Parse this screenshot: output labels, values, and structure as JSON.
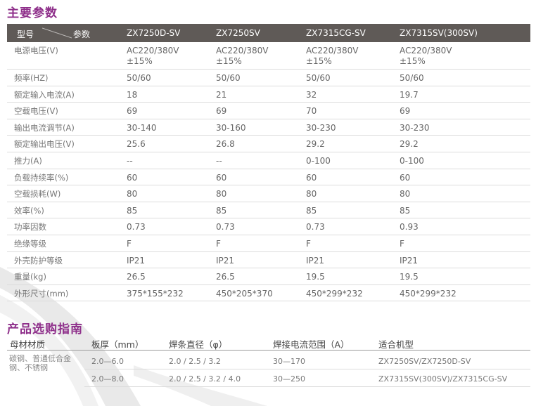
{
  "section1_title": "主要参数",
  "section2_title": "产品选购指南",
  "spec": {
    "header": {
      "type_label": "型号",
      "param_label": "参数",
      "models": [
        "ZX7250D-SV",
        "ZX7250SV",
        "ZX7315CG-SV",
        "ZX7315SV(300SV)"
      ]
    },
    "rows": [
      {
        "label": "电源电压(V)",
        "values": [
          "AC220/380V ±15%",
          "AC220/380V ±15%",
          "AC220/380V ±15%",
          "AC220/380V ±15%"
        ]
      },
      {
        "label": "频率(HZ)",
        "values": [
          "50/60",
          "50/60",
          "50/60",
          "50/60"
        ]
      },
      {
        "label": "额定输入电流(A)",
        "values": [
          "18",
          "21",
          "32",
          "19.7"
        ]
      },
      {
        "label": "空载电压(V)",
        "values": [
          "69",
          "69",
          "70",
          "69"
        ]
      },
      {
        "label": "输出电流调节(A)",
        "values": [
          "30-140",
          "30-160",
          "30-230",
          "30-230"
        ]
      },
      {
        "label": "额定输出电压(V)",
        "values": [
          "25.6",
          "26.8",
          "29.2",
          "29.2"
        ]
      },
      {
        "label": "推力(A)",
        "values": [
          "--",
          "--",
          "0-100",
          "0-100"
        ]
      },
      {
        "label": "负载持续率(%)",
        "values": [
          "60",
          "60",
          "60",
          "60"
        ]
      },
      {
        "label": "空载损耗(W)",
        "values": [
          "80",
          "80",
          "80",
          "80"
        ]
      },
      {
        "label": "效率(%)",
        "values": [
          "85",
          "85",
          "85",
          "85"
        ]
      },
      {
        "label": "功率因数",
        "values": [
          "0.73",
          "0.73",
          "0.73",
          "0.93"
        ]
      },
      {
        "label": "绝缘等级",
        "values": [
          "F",
          "F",
          "F",
          "F"
        ]
      },
      {
        "label": "外壳防护等级",
        "values": [
          "IP21",
          "IP21",
          "IP21",
          "IP21"
        ]
      },
      {
        "label": "重量(kg)",
        "values": [
          "26.5",
          "26.5",
          "19.5",
          "19.5"
        ]
      },
      {
        "label": "外形尺寸(mm)",
        "values": [
          "375*155*232",
          "450*205*370",
          "450*299*232",
          "450*299*232"
        ]
      }
    ]
  },
  "guide": {
    "headers": [
      "母材材质",
      "板厚（mm）",
      "焊条直径（φ）",
      "焊接电流范围（A）",
      "适合机型"
    ],
    "material": "碳钢、普通低合金钢、不锈钢",
    "rows": [
      {
        "thickness": "2.0—6.0",
        "rod": "2.0 / 2.5 / 3.2",
        "current": "30—170",
        "model": "ZX7250SV/ZX7250D-SV"
      },
      {
        "thickness": "2.0—8.0",
        "rod": "2.0 / 2.5 / 3.2 / 4.0",
        "current": "30—250",
        "model": "ZX7315SV(300SV)/ZX7315CG-SV"
      }
    ]
  }
}
